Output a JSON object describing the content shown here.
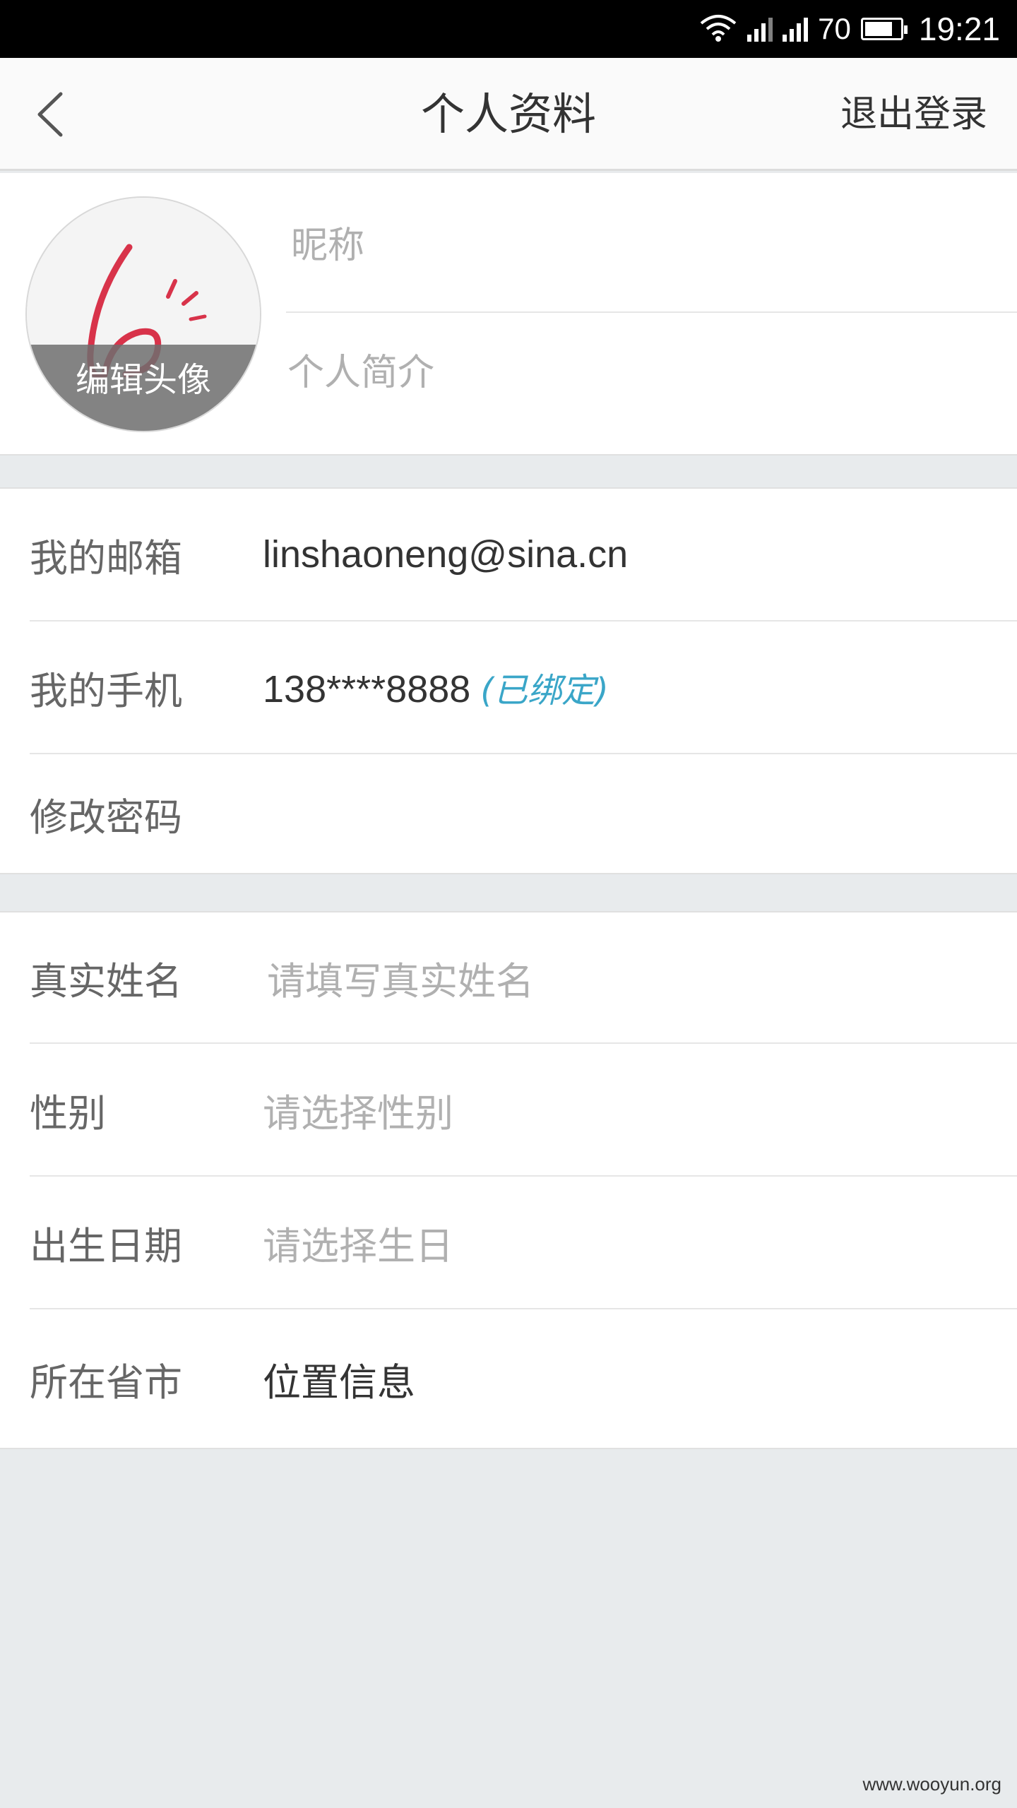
{
  "status_bar": {
    "battery_level": "70",
    "time": "19:21"
  },
  "header": {
    "title": "个人资料",
    "logout_label": "退出登录"
  },
  "profile": {
    "avatar_edit_label": "编辑头像",
    "nickname_placeholder": "昵称",
    "bio_placeholder": "个人简介"
  },
  "account": {
    "email_label": "我的邮箱",
    "email_value": "linshaoneng@sina.cn",
    "phone_label": "我的手机",
    "phone_value": "138****8888",
    "phone_bound": "(已绑定)",
    "password_label": "修改密码"
  },
  "personal": {
    "realname_label": "真实姓名",
    "realname_placeholder": "请填写真实姓名",
    "gender_label": "性别",
    "gender_placeholder": "请选择性别",
    "birthday_label": "出生日期",
    "birthday_placeholder": "请选择生日",
    "location_label": "所在省市",
    "location_value": "位置信息"
  },
  "watermark": "www.wooyun.org",
  "colors": {
    "accent": "#3aa6c8",
    "background": "#e8ebed",
    "status_bar": "#000000"
  },
  "icons": {
    "back": "chevron-left-icon",
    "wifi": "wifi-icon",
    "signal": "signal-icon",
    "battery": "battery-icon"
  }
}
